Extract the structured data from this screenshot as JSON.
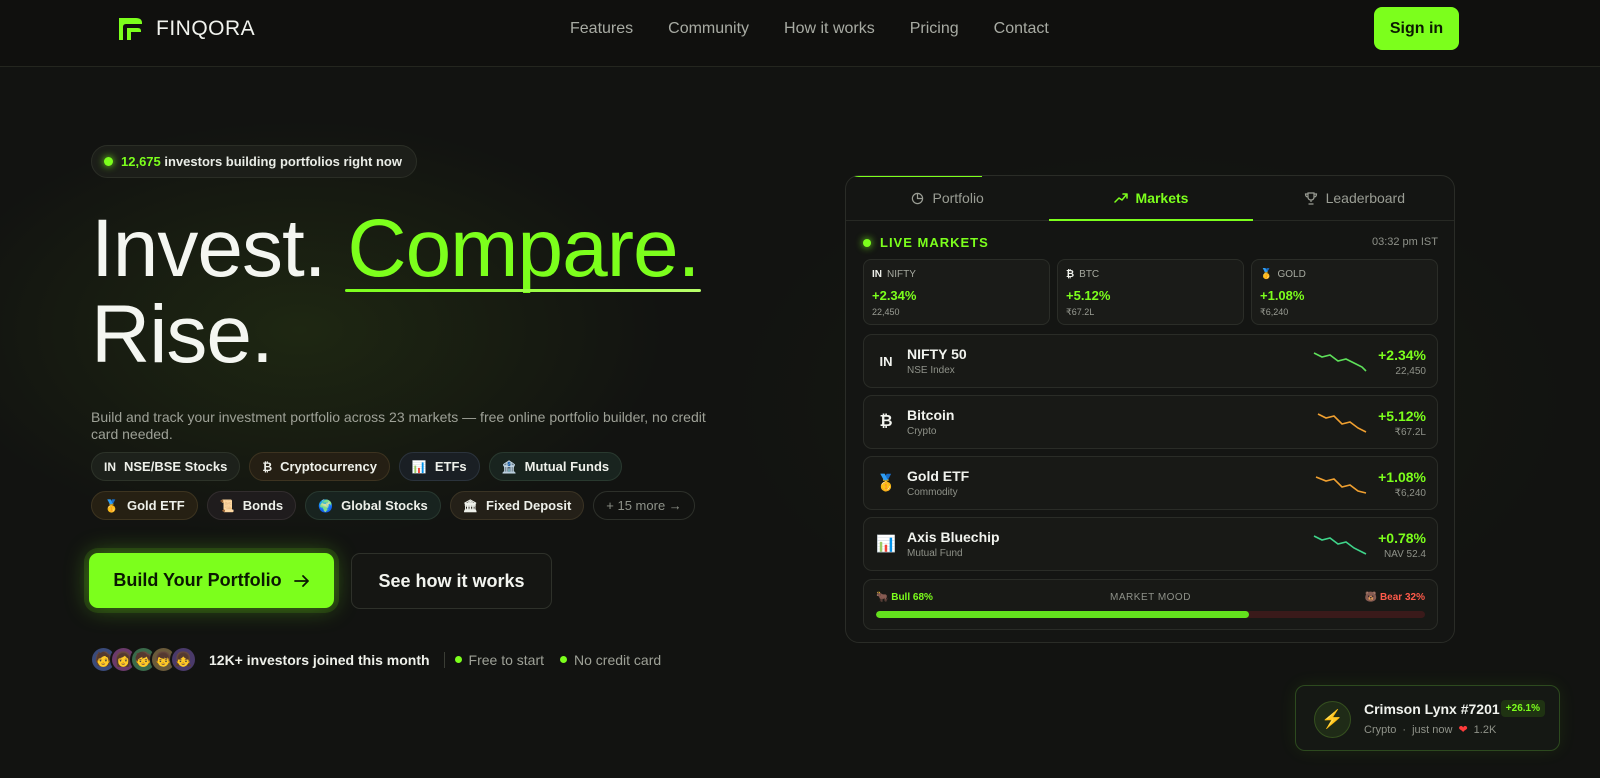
{
  "brand": {
    "name": "FINQORA",
    "accent": "#7cff1c"
  },
  "nav": {
    "links": [
      "Features",
      "Community",
      "How it works",
      "Pricing",
      "Contact"
    ],
    "signin": "Sign in"
  },
  "hero": {
    "live_count": "12,675",
    "live_text": "investors building portfolios right now",
    "title_part1": "Invest.",
    "title_accent": "Compare.",
    "title_part2": "Rise.",
    "subtitle": "Build and track your investment portfolio across 23 markets — free online portfolio builder, no credit card needed.",
    "tags": [
      {
        "icon": "IN",
        "label": "NSE/BSE Stocks"
      },
      {
        "icon": "₿",
        "label": "Cryptocurrency"
      },
      {
        "icon": "📊",
        "label": "ETFs"
      },
      {
        "icon": "🏦",
        "label": "Mutual Funds"
      },
      {
        "icon": "🥇",
        "label": "Gold ETF"
      },
      {
        "icon": "📜",
        "label": "Bonds"
      },
      {
        "icon": "🌍",
        "label": "Global Stocks"
      },
      {
        "icon": "🏛",
        "label": "Fixed Deposit"
      },
      {
        "icon": "",
        "label": "+ 15 more →"
      }
    ],
    "cta_primary": "Build Your Portfolio",
    "cta_secondary": "See how it works",
    "joined_text": "12K+ investors joined this month",
    "check1": "Free to start",
    "check2": "No credit card"
  },
  "card": {
    "tabs": [
      {
        "icon": "pie-icon",
        "label": "Portfolio"
      },
      {
        "icon": "trend-icon",
        "label": "Markets"
      },
      {
        "icon": "trophy-icon",
        "label": "Leaderboard"
      }
    ],
    "live_label": "LIVE MARKETS",
    "time": "03:32 pm IST",
    "minis": [
      {
        "icon": "IN",
        "name": "NIFTY",
        "change": "+2.34%",
        "value": "22,450"
      },
      {
        "icon": "₿",
        "name": "BTC",
        "change": "+5.12%",
        "value": "₹67.2L"
      },
      {
        "icon": "🥇",
        "name": "GOLD",
        "change": "+1.08%",
        "value": "₹6,240"
      }
    ],
    "rows": [
      {
        "icon": "IN",
        "name": "NIFTY 50",
        "sub": "NSE Index",
        "change": "+2.34%",
        "value": "22,450",
        "spark_color": "#5ee05a"
      },
      {
        "icon": "₿",
        "name": "Bitcoin",
        "sub": "Crypto",
        "change": "+5.12%",
        "value": "₹67.2L",
        "spark_color": "#f0a030"
      },
      {
        "icon": "🥇",
        "name": "Gold ETF",
        "sub": "Commodity",
        "change": "+1.08%",
        "value": "₹6,240",
        "spark_color": "#f0a030"
      },
      {
        "icon": "📊",
        "name": "Axis Bluechip",
        "sub": "Mutual Fund",
        "change": "+0.78%",
        "value": "NAV 52.4",
        "spark_color": "#3fd48a"
      }
    ],
    "mood": {
      "bull": "🐂 Bull 68%",
      "label": "MARKET MOOD",
      "bear": "🐻 Bear 32%",
      "bull_pct": 68
    }
  },
  "toast": {
    "name": "Crimson Lynx #7201",
    "badge": "+26.1%",
    "category": "Crypto",
    "time": "just now",
    "likes": "1.2K"
  }
}
